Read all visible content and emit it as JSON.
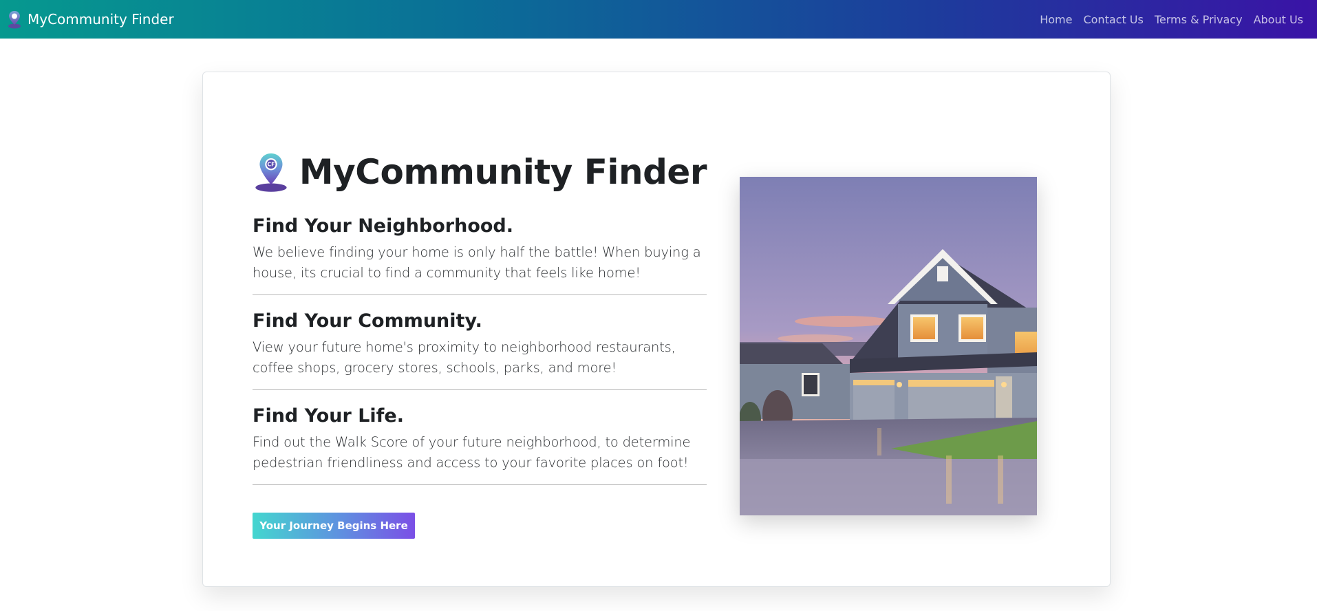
{
  "navbar": {
    "brand": "MyCommunity Finder",
    "brand_icon": "map-pin-icon",
    "links": [
      "Home",
      "Contact Us",
      "Terms & Privacy",
      "About Us"
    ],
    "gradient": [
      "#06998f",
      "#3a13a6"
    ]
  },
  "hero": {
    "logo_icon": "map-pin-cf-icon",
    "title": "MyCommunity Finder",
    "features": [
      {
        "heading": "Find Your Neighborhood.",
        "text": "We believe finding your home is only half the battle! When buying a house, its crucial to find a community that feels like home!"
      },
      {
        "heading": "Find Your Community.",
        "text": "View your future home's proximity to neighborhood restaurants, coffee shops, grocery stores, schools, parks, and more!"
      },
      {
        "heading": "Find Your Life.",
        "text": "Find out the Walk Score of your future neighborhood, to determine pedestrian friendliness and access to your favorite places on foot!"
      }
    ],
    "cta_label": "Your Journey Begins Here",
    "cta_gradient": [
      "#44d6cf",
      "#7b4fe6"
    ],
    "image": "house-at-dusk-photo"
  }
}
